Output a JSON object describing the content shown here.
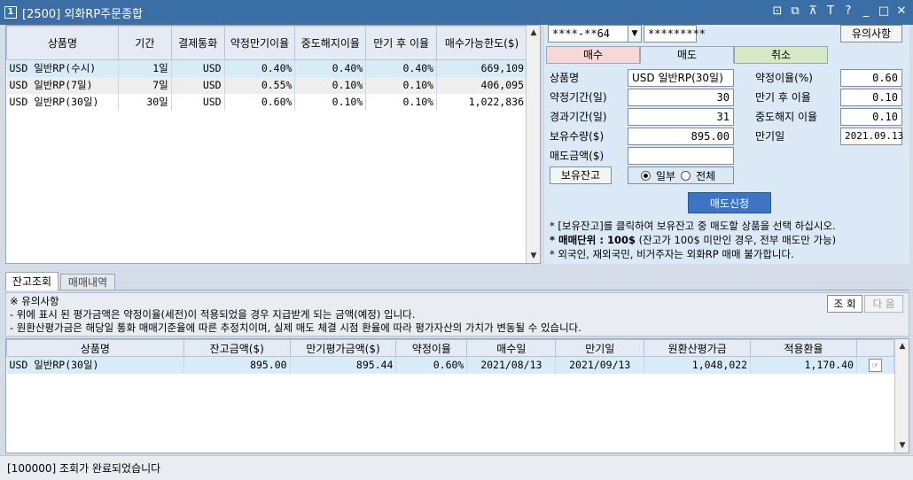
{
  "window": {
    "num": "1",
    "title": "[2500] 외화RP주문종합"
  },
  "title_icons": [
    "⊡",
    "⧉",
    "⊼",
    "T",
    "?",
    "_",
    "□",
    "✕"
  ],
  "products": {
    "headers": [
      "상품명",
      "기간",
      "결제통화",
      "약정만기이율",
      "중도해지이율",
      "만기 후 이율",
      "매수가능한도($)"
    ],
    "rows": [
      [
        "USD 일반RP(수시)",
        "1일",
        "USD",
        "0.40%",
        "0.40%",
        "0.40%",
        "669,109"
      ],
      [
        "USD 일반RP(7일)",
        "7일",
        "USD",
        "0.55%",
        "0.10%",
        "0.10%",
        "406,095"
      ],
      [
        "USD 일반RP(30일)",
        "30일",
        "USD",
        "0.60%",
        "0.10%",
        "0.10%",
        "1,022,836"
      ]
    ]
  },
  "order": {
    "account": "****-**64",
    "password": "*********",
    "notice_btn": "유의사항",
    "tabs": [
      "매수",
      "매도",
      "취소"
    ],
    "fields": {
      "product_label": "상품명",
      "product_value": "USD 일반RP(30일)",
      "term_label": "약정기간(일)",
      "term_value": "30",
      "elapsed_label": "경과기간(일)",
      "elapsed_value": "31",
      "holding_label": "보유수량($)",
      "holding_value": "895.00",
      "sell_amount_label": "매도금액($)",
      "sell_amount_value": "",
      "rate_label": "약정이율(%)",
      "rate_value": "0.60",
      "post_rate_label": "만기 후 이율",
      "post_rate_value": "0.10",
      "early_rate_label": "중도해지 이율",
      "early_rate_value": "0.10",
      "maturity_label": "만기일",
      "maturity_value": "2021.09.13"
    },
    "balance_btn": "보유잔고",
    "radio_partial": "일부",
    "radio_all": "전체",
    "submit": "매도신청",
    "notes": [
      "* [보유잔고]를 클릭하여 보유잔고 중 매도할  상품을 선택 하십시오.",
      "* 매매단위 : 100$",
      " (잔고가 100$ 미만인 경우, 전부 매도만 가능)",
      "* 외국인, 재외국민, 비거주자는 외화RP 매매 불가합니다."
    ]
  },
  "bottom_tabs": [
    "잔고조회",
    "매매내역"
  ],
  "notice": {
    "head": "※ 유의사항",
    "lines": [
      " - 위에 표시 된 평가금액은 약정이율(세전)이 적용되었을 경우 지급받게 되는 금액(예정) 입니다.",
      " - 원환산평가금은 해당일 통화 매매기준율에 따른 추정치이며, 실제 매도 체결 시점 환율에 따라 평가자산의 가치가 변동될 수 있습니다."
    ],
    "query_btn": "조 회",
    "next_btn": "다 음"
  },
  "balance": {
    "headers": [
      "상품명",
      "잔고금액($)",
      "만기평가금액($)",
      "약정이율",
      "매수일",
      "만기일",
      "원환산평가금",
      "적용환율",
      ""
    ],
    "rows": [
      [
        "USD 일반RP(30일)",
        "895.00",
        "895.44",
        "0.60%",
        "2021/08/13",
        "2021/09/13",
        "1,048,022",
        "1,170.40"
      ]
    ]
  },
  "status": "[100000] 조회가 완료되었습니다"
}
